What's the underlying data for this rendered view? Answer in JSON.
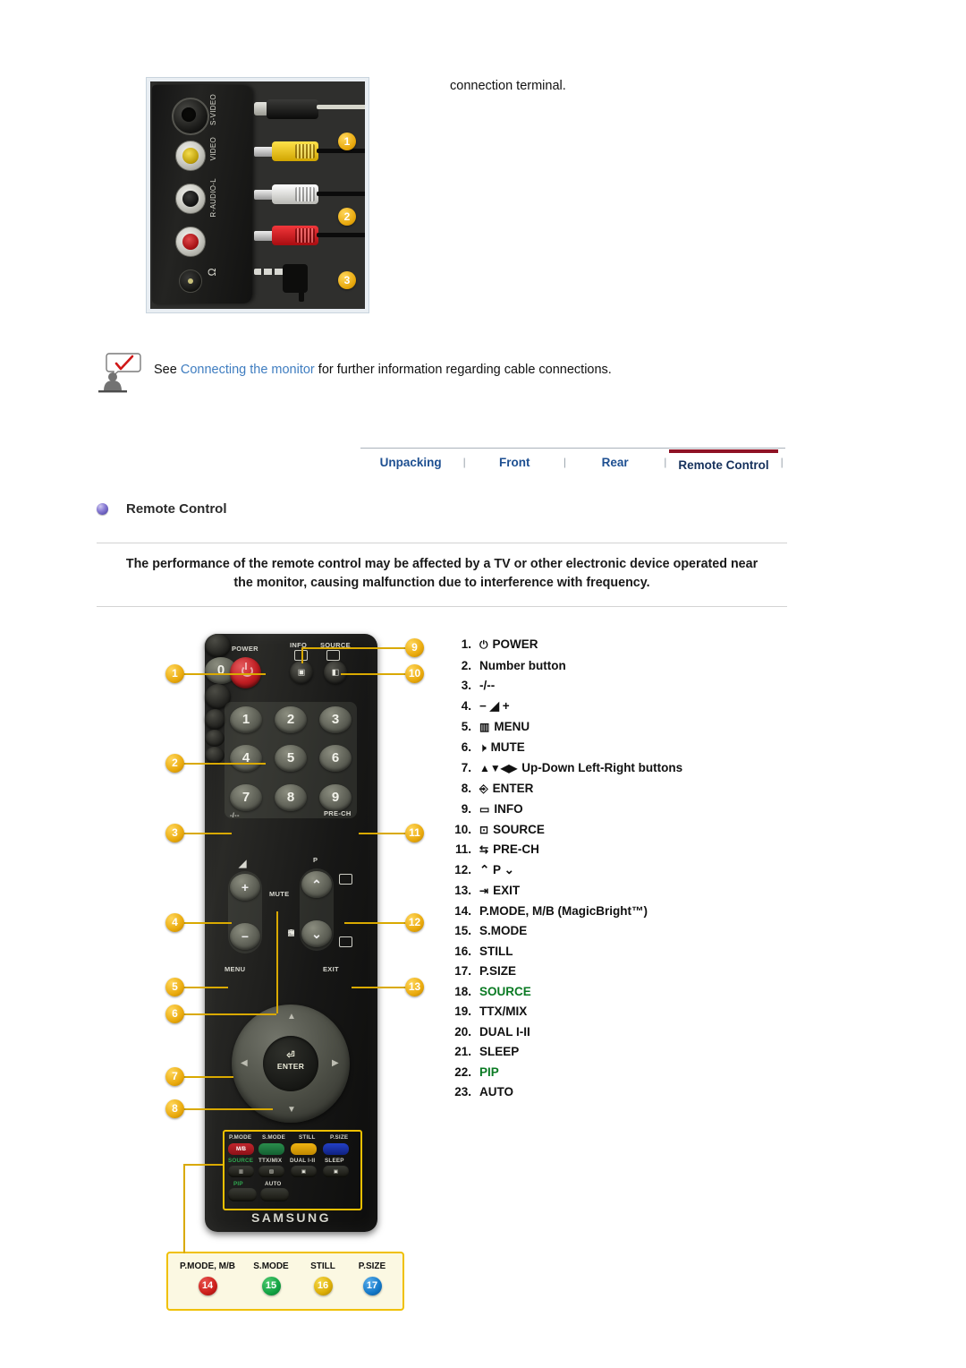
{
  "top_photo": {
    "caption": "connection terminal.",
    "port_labels": [
      "S-VIDEO",
      "VIDEO",
      "R-AUDIO-L",
      "headphone"
    ],
    "callouts": [
      "1",
      "2",
      "3"
    ],
    "alt": "AV connection terminal with S-Video, composite video, stereo audio and headphone cables"
  },
  "note": {
    "icon": "note-checkmark-icon",
    "text_before": "See ",
    "link_text": "Connecting the monitor",
    "text_after": " for further information regarding cable connections."
  },
  "tabs": {
    "items": [
      {
        "label": "Unpacking",
        "active": false
      },
      {
        "label": "Front",
        "active": false
      },
      {
        "label": "Rear",
        "active": false
      },
      {
        "label": "Remote Control",
        "active": true
      }
    ],
    "separator": "|",
    "active_color": "#8f1225",
    "link_color": "#1d4f91"
  },
  "section": {
    "bullet_icon": "sphere-bullet-icon",
    "title": "Remote Control"
  },
  "warning": {
    "line1": "The performance of the remote control may be affected by a TV or other electronic device operated near",
    "line2": "the monitor, causing malfunction due to interference with frequency."
  },
  "remote": {
    "brand": "SAMSUNG",
    "labels": {
      "power": "POWER",
      "info": "INFO",
      "source": "SOURCE",
      "prech": "PRE-CH",
      "dash": "-/--",
      "mute": "MUTE",
      "menu": "MENU",
      "exit": "EXIT",
      "p": "P",
      "enter": "ENTER"
    },
    "number_keys": [
      "1",
      "2",
      "3",
      "4",
      "5",
      "6",
      "7",
      "8",
      "9",
      "0"
    ],
    "function_rows": [
      {
        "labels": [
          "P.MODE",
          "S.MODE",
          "STILL",
          "P.SIZE"
        ],
        "colors": [
          "#a51a22",
          "#1c7a3e",
          "#e0a008",
          "#1433b0"
        ],
        "chip": "M/B"
      },
      {
        "labels": [
          "SOURCE",
          "TTX/MIX",
          "DUAL I-II",
          "SLEEP"
        ],
        "label_colors": [
          "#2fa84f",
          "#d5d5cb",
          "#d5d5cb",
          "#d5d5cb"
        ]
      },
      {
        "labels": [
          "PIP",
          "AUTO"
        ],
        "label_colors": [
          "#2fa84f",
          "#d5d5cb"
        ]
      }
    ],
    "callouts": [
      "1",
      "2",
      "3",
      "4",
      "5",
      "6",
      "7",
      "8",
      "9",
      "10",
      "11",
      "12",
      "13"
    ],
    "zoom_box": [
      {
        "label": "P.MODE, M/B",
        "number": "14",
        "color": "#cc1f1a"
      },
      {
        "label": "S.MODE",
        "number": "15",
        "color": "#12a343"
      },
      {
        "label": "STILL",
        "number": "16",
        "color": "#dcae06"
      },
      {
        "label": "P.SIZE",
        "number": "17",
        "color": "#1378c8"
      }
    ]
  },
  "legend": [
    {
      "num": "1.",
      "icon": "⏻",
      "text": "POWER",
      "green": false
    },
    {
      "num": "2.",
      "icon": "",
      "text": "Number button",
      "green": false
    },
    {
      "num": "3.",
      "icon": "",
      "text": "-/--",
      "green": false
    },
    {
      "num": "4.",
      "icon": "",
      "text": "−  ◢  +",
      "green": false
    },
    {
      "num": "5.",
      "icon": "▥",
      "text": "MENU",
      "green": false
    },
    {
      "num": "6.",
      "icon": "🕨",
      "text": "MUTE",
      "green": false
    },
    {
      "num": "7.",
      "icon": "▲▼◀▶",
      "text": "Up-Down Left-Right buttons",
      "green": false
    },
    {
      "num": "8.",
      "icon": "⎆",
      "text": "ENTER",
      "green": false
    },
    {
      "num": "9.",
      "icon": "▭",
      "text": "INFO",
      "green": false
    },
    {
      "num": "10.",
      "icon": "⊡",
      "text": "SOURCE",
      "green": false
    },
    {
      "num": "11.",
      "icon": "⇆",
      "text": "PRE-CH",
      "green": false
    },
    {
      "num": "12.",
      "icon": "",
      "text": "⌃ P ⌄",
      "green": false
    },
    {
      "num": "13.",
      "icon": "⇥",
      "text": "EXIT",
      "green": false
    },
    {
      "num": "14.",
      "icon": "",
      "text": "P.MODE, M/B (MagicBright™)",
      "green": false
    },
    {
      "num": "15.",
      "icon": "",
      "text": "S.MODE",
      "green": false
    },
    {
      "num": "16.",
      "icon": "",
      "text": "STILL",
      "green": false
    },
    {
      "num": "17.",
      "icon": "",
      "text": "P.SIZE",
      "green": false
    },
    {
      "num": "18.",
      "icon": "",
      "text": "SOURCE",
      "green": true
    },
    {
      "num": "19.",
      "icon": "",
      "text": "TTX/MIX",
      "green": false
    },
    {
      "num": "20.",
      "icon": "",
      "text": "DUAL I-II",
      "green": false
    },
    {
      "num": "21.",
      "icon": "",
      "text": "SLEEP",
      "green": false
    },
    {
      "num": "22.",
      "icon": "",
      "text": "PIP",
      "green": true
    },
    {
      "num": "23.",
      "icon": "",
      "text": "AUTO",
      "green": false
    }
  ]
}
